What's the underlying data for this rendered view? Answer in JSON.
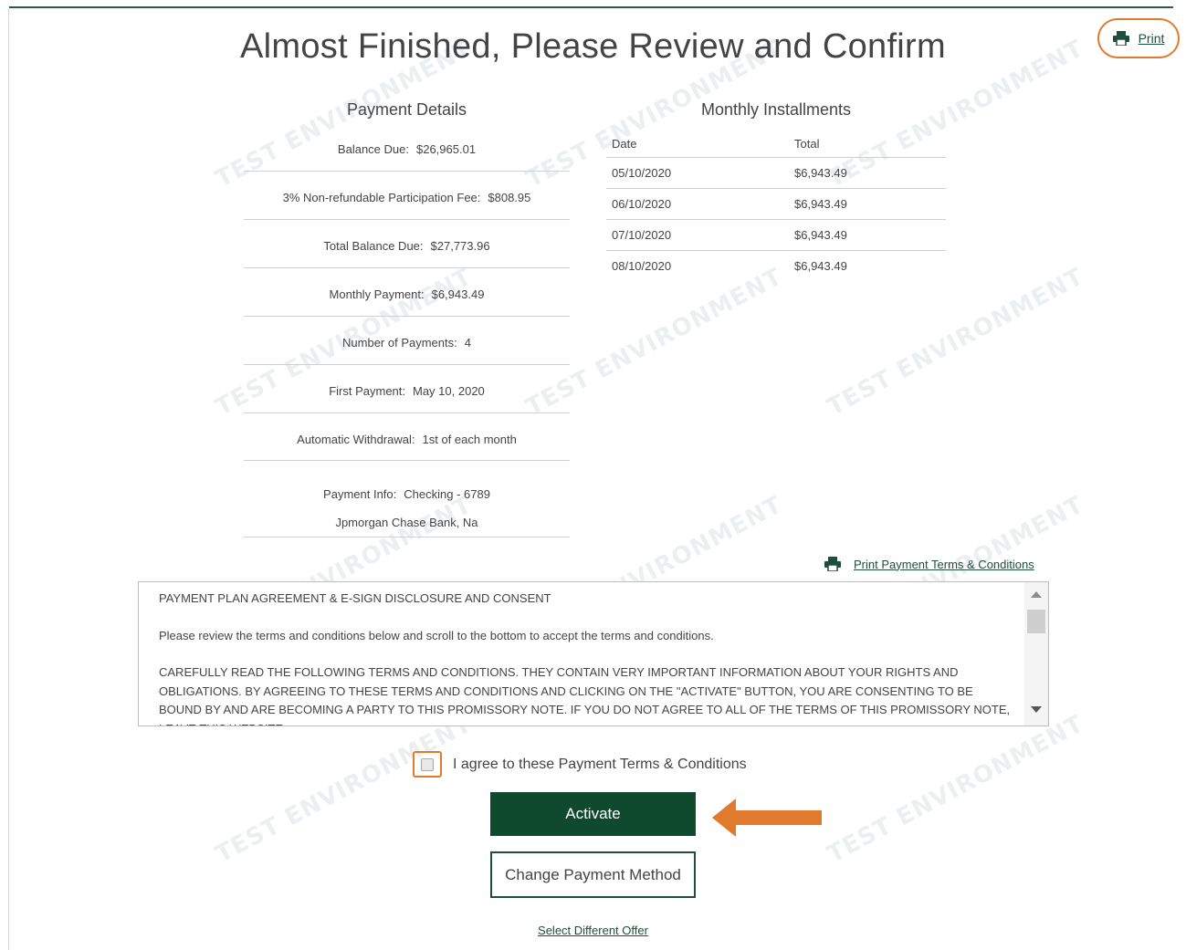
{
  "watermark": "TEST ENVIRONMENT",
  "title": "Almost Finished, Please Review and Confirm",
  "print_label": "Print",
  "payment_details": {
    "heading": "Payment Details",
    "rows": [
      {
        "label": "Balance Due:",
        "value": "$26,965.01"
      },
      {
        "label": "3% Non-refundable Participation Fee:",
        "value": "$808.95"
      },
      {
        "label": "Total Balance Due:",
        "value": "$27,773.96"
      },
      {
        "label": "Monthly Payment:",
        "value": "$6,943.49"
      },
      {
        "label": "Number of Payments:",
        "value": "4"
      },
      {
        "label": "First Payment:",
        "value": "May 10, 2020"
      },
      {
        "label": "Automatic Withdrawal:",
        "value": "1st of each month"
      }
    ],
    "payment_info": {
      "label": "Payment Info:",
      "value": "Checking - 6789",
      "bank": "Jpmorgan Chase Bank, Na"
    }
  },
  "installments": {
    "heading": "Monthly Installments",
    "columns": [
      "Date",
      "Total"
    ],
    "rows": [
      [
        "05/10/2020",
        "$6,943.49"
      ],
      [
        "06/10/2020",
        "$6,943.49"
      ],
      [
        "07/10/2020",
        "$6,943.49"
      ],
      [
        "08/10/2020",
        "$6,943.49"
      ]
    ]
  },
  "print_terms_label": "Print Payment Terms & Conditions",
  "terms": {
    "heading": "PAYMENT PLAN AGREEMENT & E-SIGN DISCLOSURE AND CONSENT",
    "intro": "Please review the terms and conditions below and scroll to the bottom to accept the terms and conditions.",
    "body": "CAREFULLY READ THE FOLLOWING TERMS AND CONDITIONS. THEY CONTAIN VERY IMPORTANT INFORMATION ABOUT YOUR RIGHTS AND OBLIGATIONS. BY AGREEING TO THESE TERMS AND CONDITIONS AND CLICKING ON THE \"ACTIVATE\" BUTTON, YOU ARE CONSENTING TO BE BOUND BY AND ARE BECOMING A PARTY TO THIS PROMISSORY NOTE. IF YOU DO NOT AGREE TO ALL OF THE TERMS OF THIS PROMISSORY NOTE, LEAVE THIS WEBSITE."
  },
  "agree_label": "I agree to these Payment Terms & Conditions",
  "activate_label": "Activate",
  "change_method_label": "Change Payment Method",
  "select_offer_label": "Select Different Offer",
  "colors": {
    "brand_green": "#0f4a2e",
    "highlight_orange": "#e07a2c"
  }
}
